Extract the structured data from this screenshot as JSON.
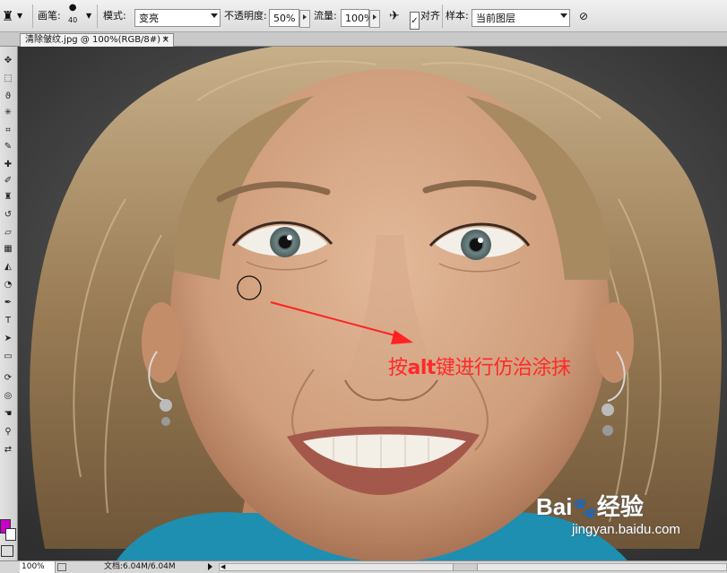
{
  "options_bar": {
    "brush_label": "画笔:",
    "brush_size": "40",
    "mode_label": "模式:",
    "mode_value": "变亮",
    "opacity_label": "不透明度:",
    "opacity_value": "50%",
    "flow_label": "流量:",
    "flow_value": "100%",
    "align_label": "对齐",
    "align_checked": "✓",
    "sample_label": "样本:",
    "sample_value": "当前图层"
  },
  "document": {
    "tab_title": "清除皱纹.jpg @ 100%(RGB/8#) *",
    "close_glyph": "×"
  },
  "tools": [
    {
      "icon": "move-icon",
      "glyph": "✥"
    },
    {
      "icon": "marquee-icon",
      "glyph": "⬚"
    },
    {
      "icon": "lasso-icon",
      "glyph": "ϑ"
    },
    {
      "icon": "magic-wand-icon",
      "glyph": "✳"
    },
    {
      "icon": "crop-icon",
      "glyph": "⌗"
    },
    {
      "icon": "eyedropper-icon",
      "glyph": "✎"
    },
    {
      "icon": "healing-brush-icon",
      "glyph": "✚"
    },
    {
      "icon": "brush-icon",
      "glyph": "✐"
    },
    {
      "icon": "clone-stamp-icon",
      "glyph": "♜"
    },
    {
      "icon": "history-brush-icon",
      "glyph": "↺"
    },
    {
      "icon": "eraser-icon",
      "glyph": "▱"
    },
    {
      "icon": "gradient-icon",
      "glyph": "▦"
    },
    {
      "icon": "blur-icon",
      "glyph": "◭"
    },
    {
      "icon": "dodge-icon",
      "glyph": "◔"
    },
    {
      "icon": "pen-icon",
      "glyph": "✒"
    },
    {
      "icon": "type-icon",
      "glyph": "T"
    },
    {
      "icon": "path-selection-icon",
      "glyph": "➤"
    },
    {
      "icon": "shape-icon",
      "glyph": "▭"
    },
    {
      "icon": "3d-rotate-icon",
      "glyph": "⟳"
    },
    {
      "icon": "3d-orbit-icon",
      "glyph": "◎"
    },
    {
      "icon": "hand-icon",
      "glyph": "☚"
    },
    {
      "icon": "zoom-icon",
      "glyph": "⚲"
    },
    {
      "icon": "swap-colors-icon",
      "glyph": "⇄"
    }
  ],
  "annotation": {
    "prefix": "按",
    "key": "alt",
    "suffix": "键进行仿治涂抹",
    "color": "#ff2a2a"
  },
  "watermark": {
    "brand": "Bai",
    "paw": "🐾",
    "brand_end": "经验",
    "url": "jingyan.baidu.com"
  },
  "status_bar": {
    "zoom": "100%",
    "doc_info": "文档:6.04M/6.04M"
  }
}
